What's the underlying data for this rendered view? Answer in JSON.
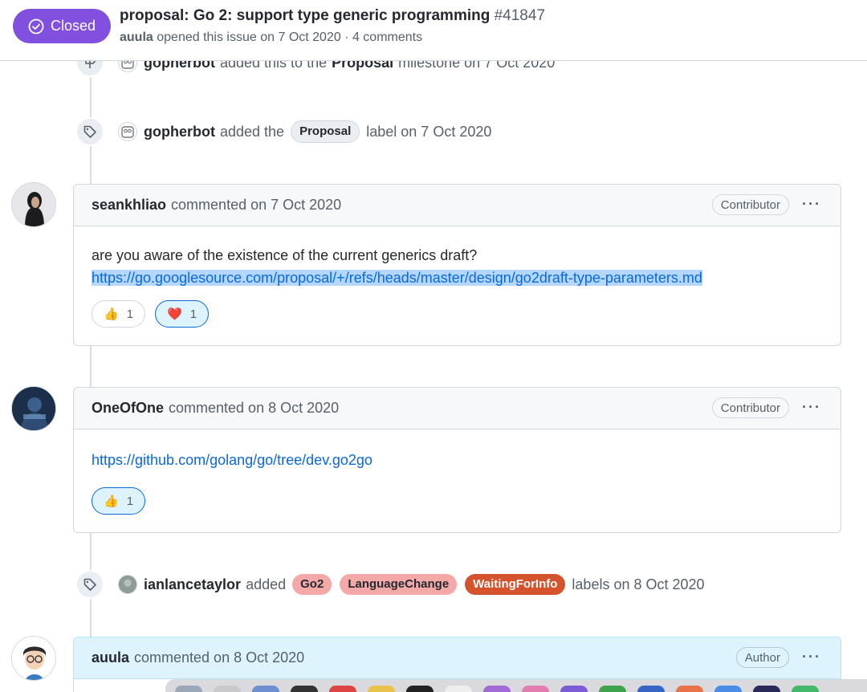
{
  "header": {
    "state": "Closed",
    "title": "proposal: Go 2: support type generic programming",
    "number": "#41847",
    "opener": "auula",
    "opened_text": "opened this issue on 7 Oct 2020 · 4 comments"
  },
  "events": [
    {
      "icon": "milestone-icon",
      "actor": "gopherbot",
      "action": "added this to the",
      "target": "Proposal",
      "suffix": "milestone on 7 Oct 2020"
    },
    {
      "icon": "tag-icon",
      "actor": "gopherbot",
      "action": "added the",
      "label": "Proposal",
      "suffix": "label on 7 Oct 2020"
    },
    {
      "icon": "tag-icon",
      "actor": "ianlancetaylor",
      "action": "added",
      "labels": [
        {
          "name": "Go2",
          "bg": "#f4a9a8",
          "fg": "#24292f"
        },
        {
          "name": "LanguageChange",
          "bg": "#f4a9a8",
          "fg": "#24292f"
        },
        {
          "name": "WaitingForInfo",
          "bg": "#d4522c",
          "fg": "#ffffff"
        }
      ],
      "suffix": "labels on 8 Oct 2020"
    }
  ],
  "comments": [
    {
      "author": "seankhliao",
      "meta": "commented on 7 Oct 2020",
      "role": "Contributor",
      "more": "···",
      "text": "are you aware of the existence of the current generics draft?",
      "link": "https://go.googlesource.com/proposal/+/refs/heads/master/design/go2draft-type-parameters.md",
      "reactions": [
        {
          "emoji": "👍",
          "count": "1",
          "active": false
        },
        {
          "emoji": "❤️",
          "count": "1",
          "active": true
        }
      ]
    },
    {
      "author": "OneOfOne",
      "meta": "commented on 8 Oct 2020",
      "role": "Contributor",
      "more": "···",
      "link": "https://github.com/golang/go/tree/dev.go2go",
      "reactions": [
        {
          "emoji": "👍",
          "count": "1",
          "active": true
        }
      ]
    },
    {
      "author": "auula",
      "meta": "commented on 8 Oct 2020",
      "role": "Author",
      "more": "···"
    }
  ],
  "colors": {
    "closed_purple": "#8250df",
    "link_blue": "#0969da",
    "selection": "#b4d7ff"
  }
}
